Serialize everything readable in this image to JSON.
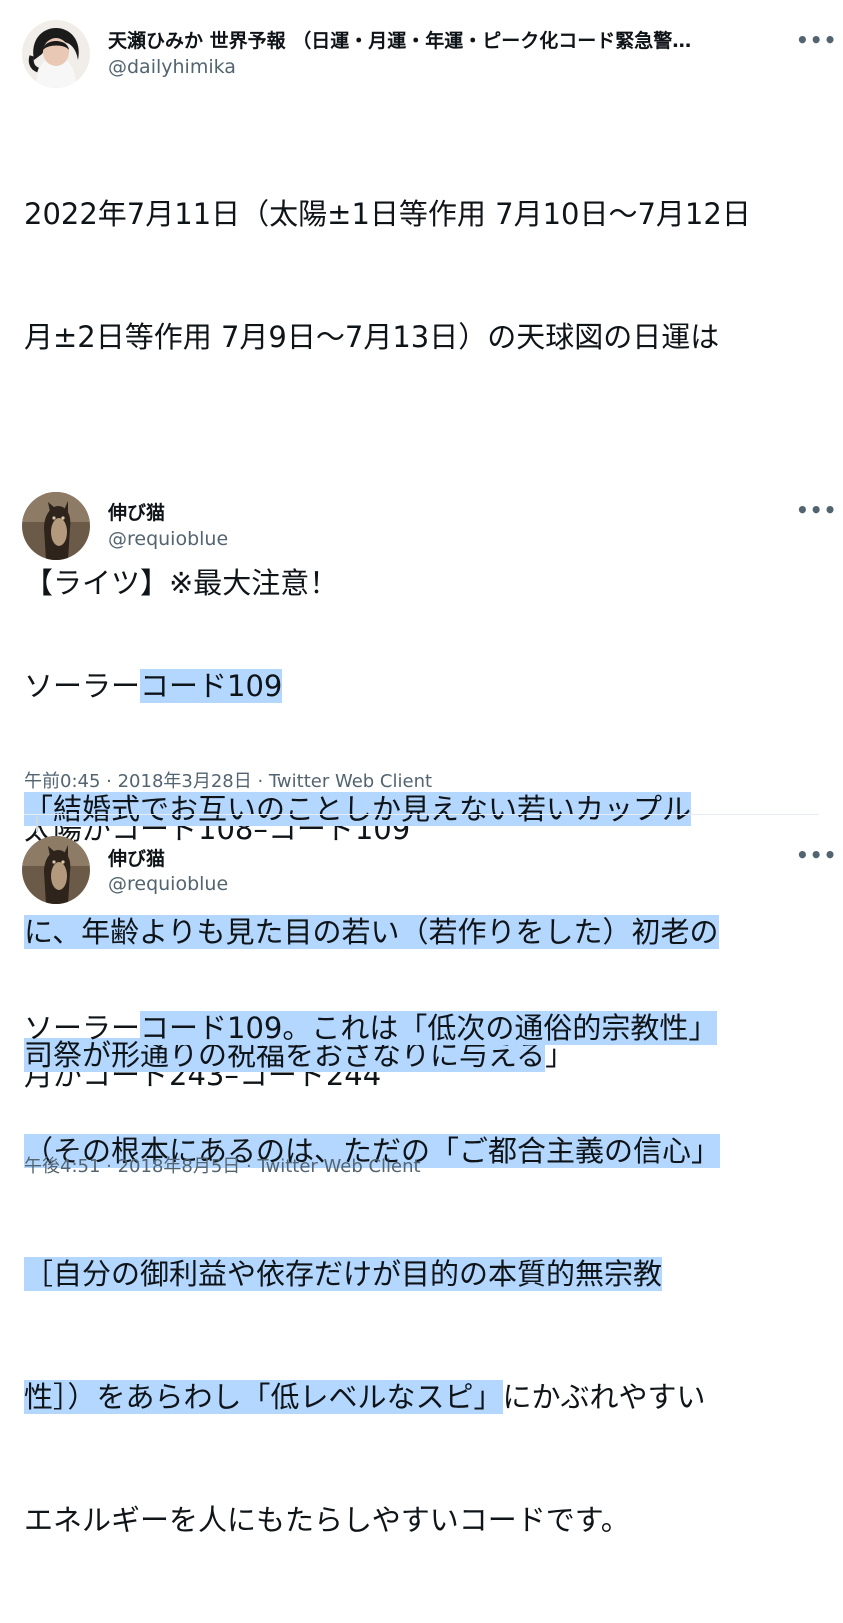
{
  "main_tweet": {
    "author": "天瀬ひみか 世界予報 （日運・月運・年運・ピーク化コード緊急警…",
    "handle": "@dailyhimika",
    "more": "•••",
    "line1": "2022年7月11日（太陽±1日等作用 7月10日〜7月12日",
    "line2": "月±2日等作用 7月9日〜7月13日）の天球図の日運は",
    "line3": "【ライツ】※最大注意！",
    "line4": "太陽がコード108–コード109",
    "line5": "月がコード243–コード244"
  },
  "quote1": {
    "author": "伸び猫",
    "handle": "@requioblue",
    "more": "•••",
    "plain1": "ソーラー",
    "hl1": "コード109",
    "hl2": "「結婚式でお互いのことしか見えない若いカップル",
    "hl3": "に、年齢よりも見た目の若い（若作りをした）初老の",
    "hl4": "司祭が形通りの祝福をおざなりに与える",
    "plain2": "」",
    "meta": "午前0:45 · 2018年3月28日 · Twitter Web Client"
  },
  "quote2": {
    "author": "伸び猫",
    "handle": "@requioblue",
    "more": "•••",
    "plain1": "ソーラー",
    "hl1": "コード109。これは「低次の通俗的宗教性」",
    "hl2": "（その根本にあるのは、ただの「ご都合主義の信心」",
    "hl3": "［自分の御利益や依存だけが目的の本質的無宗教",
    "hl4": "性］）をあらわし「低レベルなスピ」",
    "plain2": "にかぶれやすい",
    "plain3": "エネルギーを人にもたらしやすいコードです。",
    "meta": "午後4:51 · 2018年8月5日 · Twitter Web Client"
  }
}
